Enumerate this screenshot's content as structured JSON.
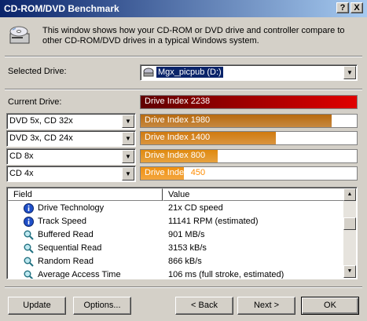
{
  "window": {
    "title": "CD-ROM/DVD Benchmark",
    "help_button": "?",
    "close_button": "X"
  },
  "intro": {
    "text": "This window shows how your CD-ROM or DVD drive and controller compare to other CD-ROM/DVD drives in a typical Windows system."
  },
  "selected_drive": {
    "label": "Selected Drive:",
    "value": "Mgx_picpub (D:)"
  },
  "current_drive": {
    "label": "Current Drive:",
    "bar_label": "Drive Index",
    "index": 2238,
    "color": "#e00000"
  },
  "comparisons": [
    {
      "drive": "DVD 5x, CD 32x",
      "bar_label": "Drive Index",
      "index": 1980,
      "color": "#b86a10"
    },
    {
      "drive": "DVD 3x, CD 24x",
      "bar_label": "Drive Index",
      "index": 1400,
      "color": "#d07a10"
    },
    {
      "drive": "CD 8x",
      "bar_label": "Drive Index",
      "index": 800,
      "color": "#e08a10"
    },
    {
      "drive": "CD 4x",
      "bar_label": "Drive Index",
      "index": 450,
      "color": "#f09010"
    }
  ],
  "bar_scale_max": 2238,
  "list": {
    "columns": [
      "Field",
      "Value"
    ],
    "rows": [
      {
        "icon": "info-icon",
        "field": "Drive Technology",
        "value": "21x CD speed"
      },
      {
        "icon": "info-icon",
        "field": "Track Speed",
        "value": "11141 RPM (estimated)"
      },
      {
        "icon": "magnifier-icon",
        "field": "Buffered Read",
        "value": "901 MB/s"
      },
      {
        "icon": "magnifier-icon",
        "field": "Sequential Read",
        "value": "3153 kB/s"
      },
      {
        "icon": "magnifier-icon",
        "field": "Random Read",
        "value": "866 kB/s"
      },
      {
        "icon": "magnifier-icon",
        "field": "Average Access Time",
        "value": "106 ms (full stroke, estimated)"
      }
    ]
  },
  "buttons": {
    "update": "Update",
    "options": "Options...",
    "back": "< Back",
    "next": "Next >",
    "ok": "OK"
  }
}
